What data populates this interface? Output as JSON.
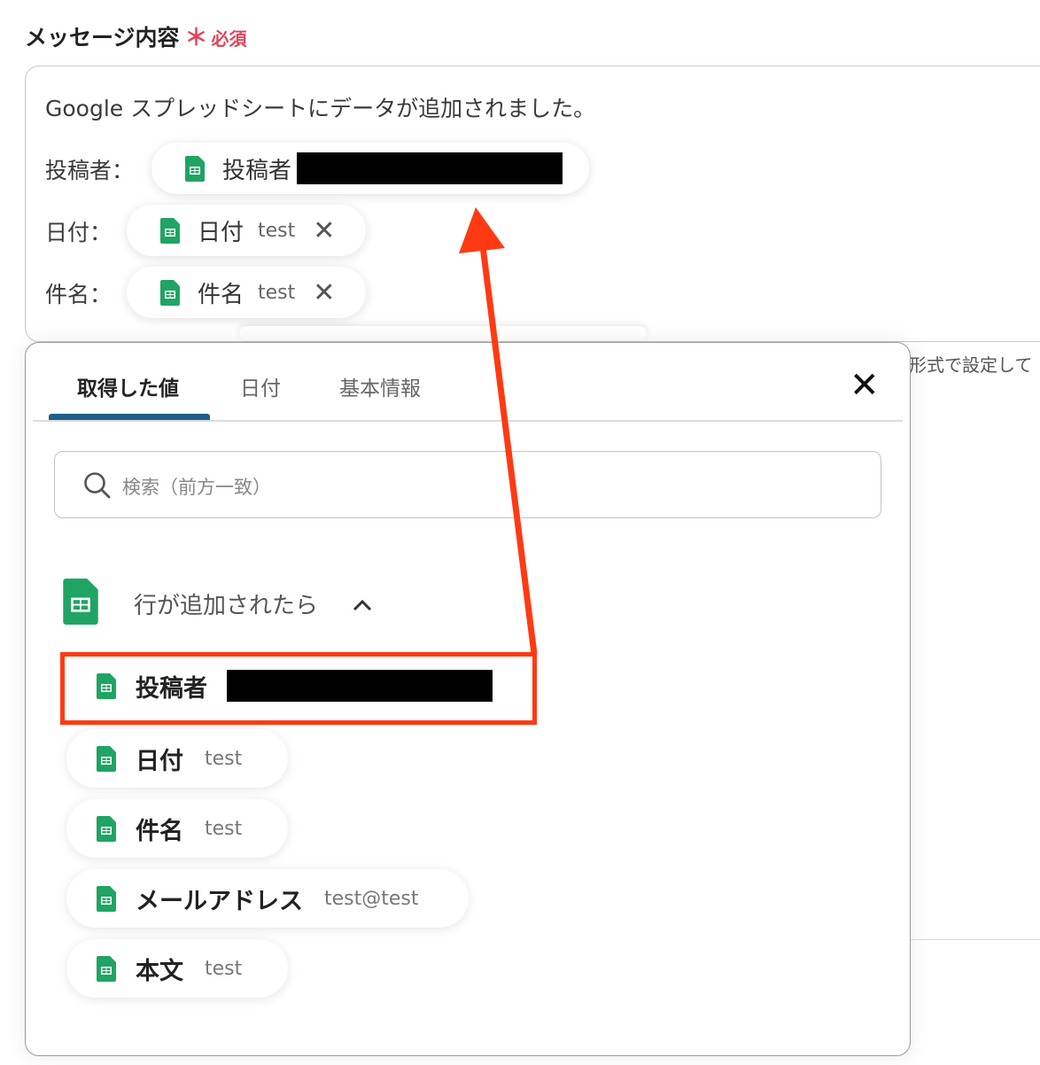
{
  "field": {
    "label": "メッセージ内容",
    "required_mark": "＊",
    "required_text": "必須"
  },
  "message": {
    "intro": "Google スプレッドシートにデータが追加されました。",
    "lines": [
      {
        "label": "投稿者：",
        "chip_name": "投稿者",
        "chip_value_redacted": true
      },
      {
        "label": "日付：",
        "chip_name": "日付",
        "chip_value": "test",
        "close": "✕"
      },
      {
        "label": "件名：",
        "chip_name": "件名",
        "chip_value": "test",
        "close": "✕"
      }
    ]
  },
  "background_hint": "形式で設定して",
  "panel": {
    "tabs": [
      {
        "label": "取得した値",
        "active": true
      },
      {
        "label": "日付",
        "active": false
      },
      {
        "label": "基本情報",
        "active": false
      }
    ],
    "close": "✕",
    "search_placeholder": "検索（前方一致）",
    "section_title": "行が追加されたら",
    "section_chevron": "^",
    "items": [
      {
        "name": "投稿者",
        "value_redacted": true,
        "highlighted": true
      },
      {
        "name": "日付",
        "value": "test"
      },
      {
        "name": "件名",
        "value": "test"
      },
      {
        "name": "メールアドレス",
        "value": "test@test"
      },
      {
        "name": "本文",
        "value": "test"
      }
    ]
  },
  "colors": {
    "required": "#e0455b",
    "tab_active_underline": "#1f5e8c",
    "highlight": "#ff3a12",
    "sheets_green": "#1fa463"
  },
  "icons": {
    "sheet": "google-sheets-icon",
    "search": "search-icon",
    "close": "close-icon",
    "chevron": "chevron-up-icon"
  }
}
